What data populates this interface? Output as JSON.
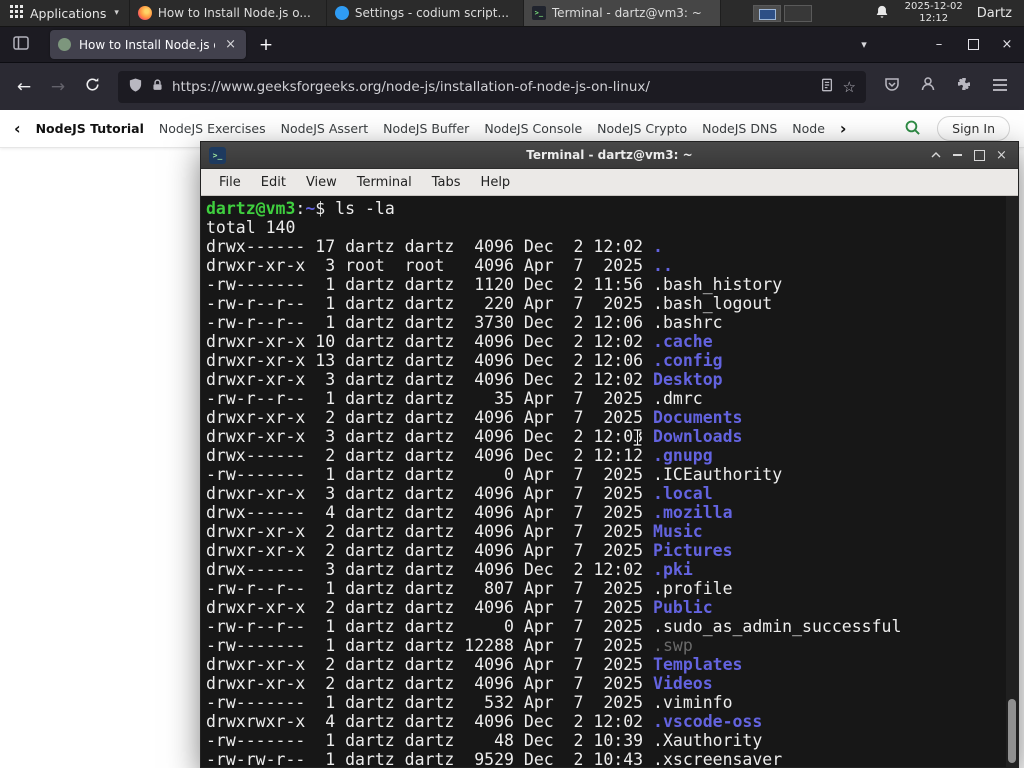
{
  "colors": {
    "gfg_green": "#2f8d46",
    "term_prompt": "#3fcf3f",
    "term_dir": "#6363e0",
    "term_file": "#ededed",
    "term_dim": "#6a6a6a"
  },
  "panel": {
    "applications_label": "Applications",
    "tasks": [
      {
        "label": "How to Install Node.js o..."
      },
      {
        "label": "Settings - codium script..."
      },
      {
        "label": "Terminal - dartz@vm3: ~"
      }
    ],
    "clock_date": "2025-12-02",
    "clock_time": "12:12",
    "user": "Dartz"
  },
  "browser": {
    "tab_title": "How to Install Node.js on",
    "tab_close": "×",
    "new_tab": "+",
    "all_tabs_chevron": "▾",
    "back": "←",
    "forward": "→",
    "url": "https://www.geeksforgeeks.org/node-js/installation-of-node-js-on-linux/",
    "bookmark_star": "☆",
    "minimize": "–",
    "close": "×"
  },
  "gfg_nav": {
    "back_chevron": "‹",
    "primary": "NodeJS Tutorial",
    "items": [
      "NodeJS Exercises",
      "NodeJS Assert",
      "NodeJS Buffer",
      "NodeJS Console",
      "NodeJS Crypto",
      "NodeJS DNS",
      "Node"
    ],
    "forward_chevron": "›",
    "sign_in": "Sign In"
  },
  "terminal": {
    "title": "Terminal - dartz@vm3: ~",
    "app_icon_glyph": ">_",
    "menu": [
      "File",
      "Edit",
      "View",
      "Terminal",
      "Tabs",
      "Help"
    ],
    "close_glyph": "×",
    "prompt_user": "dartz@vm3",
    "prompt_sep": ":",
    "prompt_path": "~",
    "prompt_symbol": "$ ",
    "command": "ls -la",
    "total_line": "total 140",
    "files": [
      {
        "perms": "drwx------",
        "links": "17",
        "owner": "dartz",
        "group": "dartz",
        "size": "4096",
        "month": "Dec",
        "day": "2",
        "time": "12:02",
        "name": ".",
        "kind": "dir"
      },
      {
        "perms": "drwxr-xr-x",
        "links": "3",
        "owner": "root",
        "group": "root",
        "size": "4096",
        "month": "Apr",
        "day": "7",
        "time": "2025",
        "name": "..",
        "kind": "dir"
      },
      {
        "perms": "-rw-------",
        "links": "1",
        "owner": "dartz",
        "group": "dartz",
        "size": "1120",
        "month": "Dec",
        "day": "2",
        "time": "11:56",
        "name": ".bash_history",
        "kind": "file"
      },
      {
        "perms": "-rw-r--r--",
        "links": "1",
        "owner": "dartz",
        "group": "dartz",
        "size": "220",
        "month": "Apr",
        "day": "7",
        "time": "2025",
        "name": ".bash_logout",
        "kind": "file"
      },
      {
        "perms": "-rw-r--r--",
        "links": "1",
        "owner": "dartz",
        "group": "dartz",
        "size": "3730",
        "month": "Dec",
        "day": "2",
        "time": "12:06",
        "name": ".bashrc",
        "kind": "file"
      },
      {
        "perms": "drwxr-xr-x",
        "links": "10",
        "owner": "dartz",
        "group": "dartz",
        "size": "4096",
        "month": "Dec",
        "day": "2",
        "time": "12:02",
        "name": ".cache",
        "kind": "dir"
      },
      {
        "perms": "drwxr-xr-x",
        "links": "13",
        "owner": "dartz",
        "group": "dartz",
        "size": "4096",
        "month": "Dec",
        "day": "2",
        "time": "12:06",
        "name": ".config",
        "kind": "dir"
      },
      {
        "perms": "drwxr-xr-x",
        "links": "3",
        "owner": "dartz",
        "group": "dartz",
        "size": "4096",
        "month": "Dec",
        "day": "2",
        "time": "12:02",
        "name": "Desktop",
        "kind": "dir"
      },
      {
        "perms": "-rw-r--r--",
        "links": "1",
        "owner": "dartz",
        "group": "dartz",
        "size": "35",
        "month": "Apr",
        "day": "7",
        "time": "2025",
        "name": ".dmrc",
        "kind": "file"
      },
      {
        "perms": "drwxr-xr-x",
        "links": "2",
        "owner": "dartz",
        "group": "dartz",
        "size": "4096",
        "month": "Apr",
        "day": "7",
        "time": "2025",
        "name": "Documents",
        "kind": "dir"
      },
      {
        "perms": "drwxr-xr-x",
        "links": "3",
        "owner": "dartz",
        "group": "dartz",
        "size": "4096",
        "month": "Dec",
        "day": "2",
        "time": "12:03",
        "name": "Downloads",
        "kind": "dir"
      },
      {
        "perms": "drwx------",
        "links": "2",
        "owner": "dartz",
        "group": "dartz",
        "size": "4096",
        "month": "Dec",
        "day": "2",
        "time": "12:12",
        "name": ".gnupg",
        "kind": "dir"
      },
      {
        "perms": "-rw-------",
        "links": "1",
        "owner": "dartz",
        "group": "dartz",
        "size": "0",
        "month": "Apr",
        "day": "7",
        "time": "2025",
        "name": ".ICEauthority",
        "kind": "file"
      },
      {
        "perms": "drwxr-xr-x",
        "links": "3",
        "owner": "dartz",
        "group": "dartz",
        "size": "4096",
        "month": "Apr",
        "day": "7",
        "time": "2025",
        "name": ".local",
        "kind": "dir"
      },
      {
        "perms": "drwx------",
        "links": "4",
        "owner": "dartz",
        "group": "dartz",
        "size": "4096",
        "month": "Apr",
        "day": "7",
        "time": "2025",
        "name": ".mozilla",
        "kind": "dir"
      },
      {
        "perms": "drwxr-xr-x",
        "links": "2",
        "owner": "dartz",
        "group": "dartz",
        "size": "4096",
        "month": "Apr",
        "day": "7",
        "time": "2025",
        "name": "Music",
        "kind": "dir"
      },
      {
        "perms": "drwxr-xr-x",
        "links": "2",
        "owner": "dartz",
        "group": "dartz",
        "size": "4096",
        "month": "Apr",
        "day": "7",
        "time": "2025",
        "name": "Pictures",
        "kind": "dir"
      },
      {
        "perms": "drwx------",
        "links": "3",
        "owner": "dartz",
        "group": "dartz",
        "size": "4096",
        "month": "Dec",
        "day": "2",
        "time": "12:02",
        "name": ".pki",
        "kind": "dir"
      },
      {
        "perms": "-rw-r--r--",
        "links": "1",
        "owner": "dartz",
        "group": "dartz",
        "size": "807",
        "month": "Apr",
        "day": "7",
        "time": "2025",
        "name": ".profile",
        "kind": "file"
      },
      {
        "perms": "drwxr-xr-x",
        "links": "2",
        "owner": "dartz",
        "group": "dartz",
        "size": "4096",
        "month": "Apr",
        "day": "7",
        "time": "2025",
        "name": "Public",
        "kind": "dir"
      },
      {
        "perms": "-rw-r--r--",
        "links": "1",
        "owner": "dartz",
        "group": "dartz",
        "size": "0",
        "month": "Apr",
        "day": "7",
        "time": "2025",
        "name": ".sudo_as_admin_successful",
        "kind": "file"
      },
      {
        "perms": "-rw-------",
        "links": "1",
        "owner": "dartz",
        "group": "dartz",
        "size": "12288",
        "month": "Apr",
        "day": "7",
        "time": "2025",
        "name": ".swp",
        "kind": "dim"
      },
      {
        "perms": "drwxr-xr-x",
        "links": "2",
        "owner": "dartz",
        "group": "dartz",
        "size": "4096",
        "month": "Apr",
        "day": "7",
        "time": "2025",
        "name": "Templates",
        "kind": "dir"
      },
      {
        "perms": "drwxr-xr-x",
        "links": "2",
        "owner": "dartz",
        "group": "dartz",
        "size": "4096",
        "month": "Apr",
        "day": "7",
        "time": "2025",
        "name": "Videos",
        "kind": "dir"
      },
      {
        "perms": "-rw-------",
        "links": "1",
        "owner": "dartz",
        "group": "dartz",
        "size": "532",
        "month": "Apr",
        "day": "7",
        "time": "2025",
        "name": ".viminfo",
        "kind": "file"
      },
      {
        "perms": "drwxrwxr-x",
        "links": "4",
        "owner": "dartz",
        "group": "dartz",
        "size": "4096",
        "month": "Dec",
        "day": "2",
        "time": "12:02",
        "name": ".vscode-oss",
        "kind": "dir"
      },
      {
        "perms": "-rw-------",
        "links": "1",
        "owner": "dartz",
        "group": "dartz",
        "size": "48",
        "month": "Dec",
        "day": "2",
        "time": "10:39",
        "name": ".Xauthority",
        "kind": "file"
      },
      {
        "perms": "-rw-rw-r--",
        "links": "1",
        "owner": "dartz",
        "group": "dartz",
        "size": "9529",
        "month": "Dec",
        "day": "2",
        "time": "10:43",
        "name": ".xscreensaver",
        "kind": "file"
      }
    ]
  }
}
